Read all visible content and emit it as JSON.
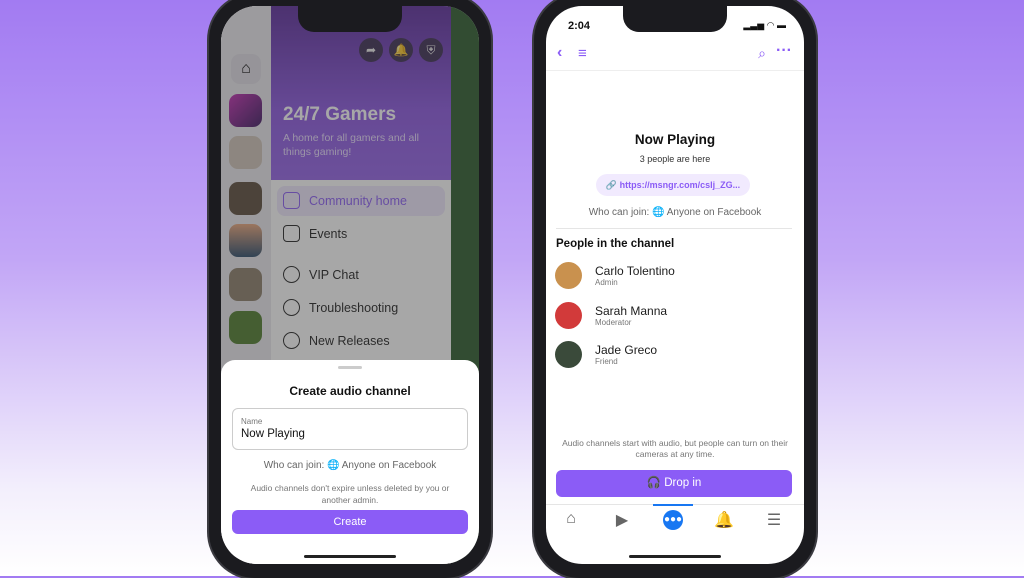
{
  "left_phone": {
    "community": {
      "title": "24/7 Gamers",
      "description": "A home for all gamers and all things gaming!"
    },
    "menu": [
      "Community home",
      "Events",
      "VIP Chat",
      "Troubleshooting",
      "New Releases"
    ],
    "sheet": {
      "title": "Create audio channel",
      "name_label": "Name",
      "name_value": "Now Playing",
      "who_label": "Who can join:",
      "who_value": "Anyone on Facebook",
      "note": "Audio channels don't expire unless deleted by you or another admin.",
      "create_label": "Create"
    }
  },
  "right_phone": {
    "time": "2:04",
    "channel_title": "Now Playing",
    "people_count": "3 people are here",
    "link": "https://msngr.com/cslj_ZG...",
    "who_label": "Who can join:",
    "who_value": "Anyone on Facebook",
    "section_title": "People in the channel",
    "people": [
      {
        "name": "Carlo Tolentino",
        "role": "Admin"
      },
      {
        "name": "Sarah Manna",
        "role": "Moderator"
      },
      {
        "name": "Jade Greco",
        "role": "Friend"
      }
    ],
    "note": "Audio channels start with audio, but people can turn on their cameras at any time.",
    "drop_in_label": "Drop in",
    "tabs": [
      "home-icon",
      "video-icon",
      "groups-icon",
      "bell-icon",
      "menu-icon"
    ],
    "active_tab": "groups-icon"
  },
  "colors": {
    "accent": "#8b5cf6",
    "active_tab": "#1877f2"
  }
}
